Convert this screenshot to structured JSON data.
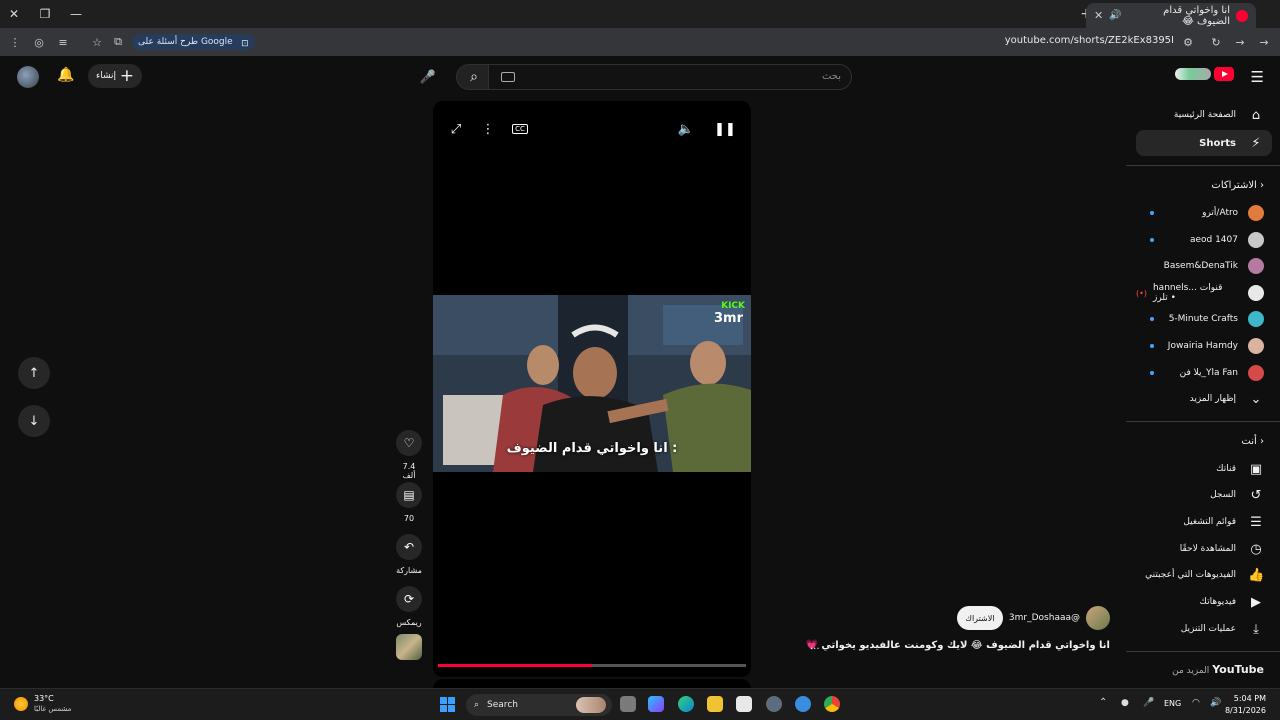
{
  "browser": {
    "tab_title": "انا واخواتي قدام الضيوف 😂",
    "url": "youtube.com/shorts/ZE2kEx8395I",
    "google_chip": "طرح أسئلة على Google"
  },
  "header": {
    "search_placeholder": "بحث",
    "create_label": "إنشاء"
  },
  "sidebar": {
    "home": "الصفحة الرئيسية",
    "shorts": "Shorts",
    "subscriptions_heading": "الاشتراكات",
    "subscriptions": [
      {
        "name": "أترو/Atro",
        "color": "#e07b3c"
      },
      {
        "name": "aeod 1407",
        "color": "#c8c8c8"
      },
      {
        "name": "Basem&DenaTik",
        "color": "#b47aa0"
      },
      {
        "name": "hannels... قنوات تلرز •",
        "live": "(•)",
        "color": "#e8e8e8"
      },
      {
        "name": "5-Minute Crafts",
        "color": "#3fb7c8"
      },
      {
        "name": "Jowairia Hamdy",
        "color": "#d9b2a0"
      },
      {
        "name": "يلا فن_Yla Fan",
        "color": "#d84a4a"
      }
    ],
    "show_more": "إظهار المزيد",
    "you_heading": "أنت",
    "you_items": [
      {
        "label": "قناتك",
        "icon": "channel-icon"
      },
      {
        "label": "السجل",
        "icon": "history-icon"
      },
      {
        "label": "قوائم التشغيل",
        "icon": "playlists-icon"
      },
      {
        "label": "المشاهدة لاحقًا",
        "icon": "watch-later-icon"
      },
      {
        "label": "الفيديوهات التي أعجبتني",
        "icon": "liked-icon"
      },
      {
        "label": "فيديوهاتك",
        "icon": "your-videos-icon"
      },
      {
        "label": "عمليات التنزيل",
        "icon": "downloads-icon"
      }
    ],
    "more_from": "المزيد من",
    "more_from_brand": "YouTube"
  },
  "player": {
    "caption": "انا واخواتي قدام الضيوف :",
    "kick_badge": "KICK",
    "kick_name": "3mr",
    "progress": 0.5
  },
  "actions": {
    "likes": "7.4 ألف",
    "comments": "70",
    "share": "مشاركة",
    "remix": "ريمكس"
  },
  "video": {
    "channel": "@3mr_Doshaaa",
    "subscribe": "الاشتراك",
    "title": "انا واخواتي قدام الضيوف 😂 لايك وكومنت عالفيديو يخواتي 💗",
    "more": "..."
  },
  "taskbar": {
    "temp": "33°C",
    "weather": "مشمس غالبًا",
    "search": "Search",
    "lang": "ENG",
    "time": "5:04 PM",
    "date": "8/31/2026"
  }
}
